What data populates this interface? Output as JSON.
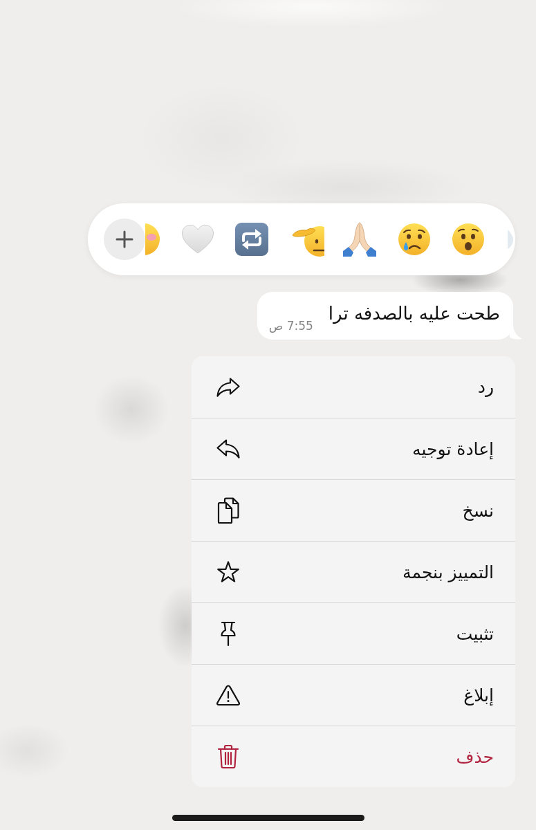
{
  "message": {
    "text": "طحت عليه بالصدفه ترا",
    "time": "7:55 ص"
  },
  "context_menu": {
    "items": [
      {
        "label": "رد",
        "kind": "reply",
        "destructive": false
      },
      {
        "label": "إعادة توجيه",
        "kind": "forward",
        "destructive": false
      },
      {
        "label": "نسخ",
        "kind": "copy",
        "destructive": false
      },
      {
        "label": "التمييز بنجمة",
        "kind": "star",
        "destructive": false
      },
      {
        "label": "تثبيت",
        "kind": "pin",
        "destructive": false
      },
      {
        "label": "إبلاغ",
        "kind": "report",
        "destructive": false
      },
      {
        "label": "حذف",
        "kind": "delete",
        "destructive": true
      }
    ]
  }
}
